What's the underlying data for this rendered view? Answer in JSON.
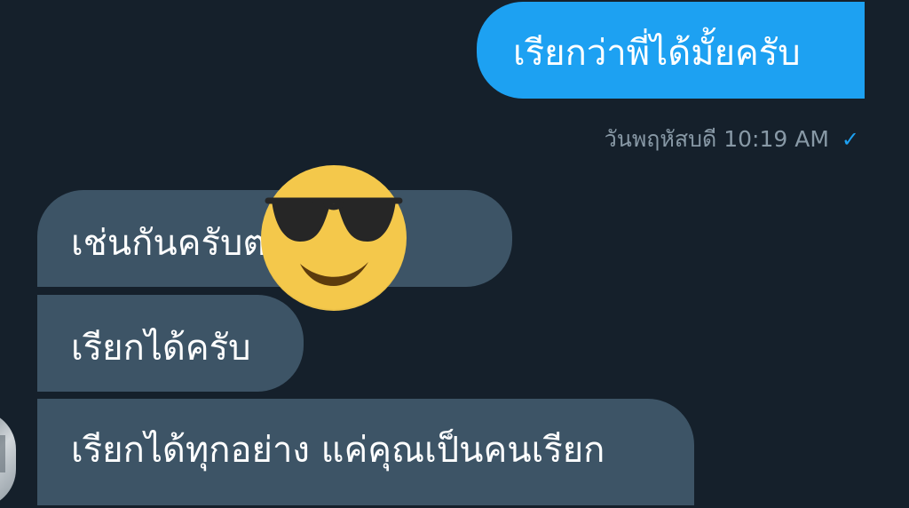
{
  "conversation": {
    "sent": {
      "text": "เรียกว่าพี่ได้มั้ยครับ",
      "timestamp": "วันพฤหัสบดี 10:19 AM",
      "status_icon": "✓"
    },
    "received": [
      {
        "text": "เช่นกันครับต                .ยิ้ม"
      },
      {
        "text": "เรียกได้ครับ"
      },
      {
        "text": "เรียกได้ทุกอย่าง แค่คุณเป็นคนเรียก"
      }
    ]
  },
  "decorations": {
    "sticker": "sunglasses-emoji-sticker",
    "avatar": "contact-avatar"
  },
  "colors": {
    "background": "#15202b",
    "sent_bubble": "#1da1f2",
    "received_bubble": "#3d5466",
    "text": "#ffffff",
    "meta": "#8899a6"
  }
}
